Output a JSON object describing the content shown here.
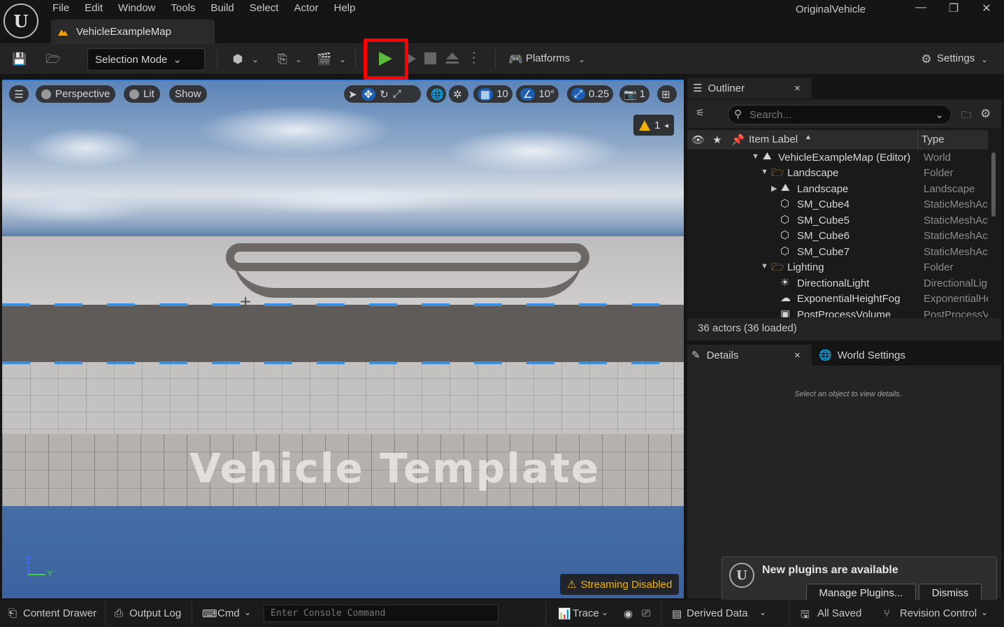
{
  "menu": [
    "File",
    "Edit",
    "Window",
    "Tools",
    "Build",
    "Select",
    "Actor",
    "Help"
  ],
  "document_tab": "VehicleExampleMap",
  "window_title": "OriginalVehicle",
  "window_controls": {
    "minimize": "—",
    "restore": "❐",
    "close": "✕"
  },
  "toolbar": {
    "selection_mode": "Selection Mode",
    "platforms": "Platforms",
    "settings": "Settings"
  },
  "viewport": {
    "perspective": "Perspective",
    "lit": "Lit",
    "show": "Show",
    "grid_snap": "10",
    "rotation_snap": "10°",
    "scale_snap": "0.25",
    "camera_speed": "1",
    "warning_count": "1",
    "overlay_text": "Vehicle Template",
    "streaming": "Streaming Disabled",
    "axis_z": "Z",
    "axis_y": "Y"
  },
  "outliner": {
    "tab_label": "Outliner",
    "search_placeholder": "Search...",
    "col_label": "Item Label",
    "col_type": "Type",
    "rows": [
      {
        "label": "VehicleExampleMap (Editor)",
        "type": "World"
      },
      {
        "label": "Landscape",
        "type": "Folder"
      },
      {
        "label": "Landscape",
        "type": "Landscape"
      },
      {
        "label": "SM_Cube4",
        "type": "StaticMeshActor"
      },
      {
        "label": "SM_Cube5",
        "type": "StaticMeshActor"
      },
      {
        "label": "SM_Cube6",
        "type": "StaticMeshActor"
      },
      {
        "label": "SM_Cube7",
        "type": "StaticMeshActor"
      },
      {
        "label": "Lighting",
        "type": "Folder"
      },
      {
        "label": "DirectionalLight",
        "type": "DirectionalLight"
      },
      {
        "label": "ExponentialHeightFog",
        "type": "ExponentialHeightFog"
      },
      {
        "label": "PostProcessVolume",
        "type": "PostProcessVolume"
      }
    ],
    "actor_count": "36 actors (36 loaded)"
  },
  "details": {
    "tab_label": "Details",
    "world_settings": "World Settings",
    "empty_msg": "Select an object to view details."
  },
  "notification": {
    "title": "New plugins are available",
    "manage": "Manage Plugins...",
    "dismiss": "Dismiss"
  },
  "bottombar": {
    "content_drawer": "Content Drawer",
    "output_log": "Output Log",
    "cmd": "Cmd",
    "console_placeholder": "Enter Console Command",
    "trace": "Trace",
    "derived_data": "Derived Data",
    "all_saved": "All Saved",
    "revision_control": "Revision Control"
  }
}
